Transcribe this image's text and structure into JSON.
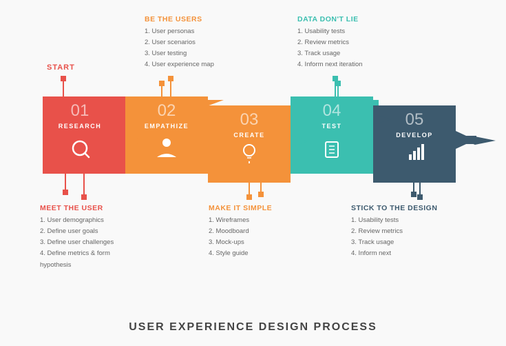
{
  "title": "USER EXPERIENCE DESIGN PROCESS",
  "start_label": "START",
  "steps": [
    {
      "id": "01",
      "label": "RESEARCH",
      "icon": "search",
      "color": "#e8514a",
      "color_light": "#ec6b65"
    },
    {
      "id": "02",
      "label": "EMPATHIZE",
      "icon": "person",
      "color": "#f4923a",
      "color_light": "#f6a35e"
    },
    {
      "id": "03",
      "label": "CREATE",
      "icon": "lightbulb",
      "color": "#f4923a",
      "color_light": "#f6a35e"
    },
    {
      "id": "04",
      "label": "TEST",
      "icon": "clipboard",
      "color": "#3bbfb0",
      "color_light": "#55ccc1"
    },
    {
      "id": "05",
      "label": "DEVELOP",
      "icon": "chart",
      "color": "#3d5a6e",
      "color_light": "#4e6e84"
    }
  ],
  "annotations_top": [
    {
      "title": "BE THE USERS",
      "title_color": "orange",
      "items": [
        "1. User personas",
        "2. User scenarios",
        "3. User testing",
        "4. User experience map"
      ]
    },
    {
      "title": "DATA DON'T LIE",
      "title_color": "teal",
      "items": [
        "1. Usability tests",
        "2. Review metrics",
        "3. Track usage",
        "4. Inform next iteration"
      ]
    }
  ],
  "annotations_bottom": [
    {
      "title": "MEET THE USER",
      "title_color": "coral",
      "items": [
        "1. User demographics",
        "2. Define user goals",
        "3. Define user challenges",
        "4. Define metrics & form hypothesis"
      ]
    },
    {
      "title": "MAKE IT SIMPLE",
      "title_color": "orange",
      "items": [
        "1. Wireframes",
        "2. Moodboard",
        "3. Mock-ups",
        "4. Style guide"
      ]
    },
    {
      "title": "STICK TO THE DESIGN",
      "title_color": "dark",
      "items": [
        "1. Usability tests",
        "2. Review metrics",
        "3. Track usage",
        "4. Inform next"
      ]
    }
  ]
}
